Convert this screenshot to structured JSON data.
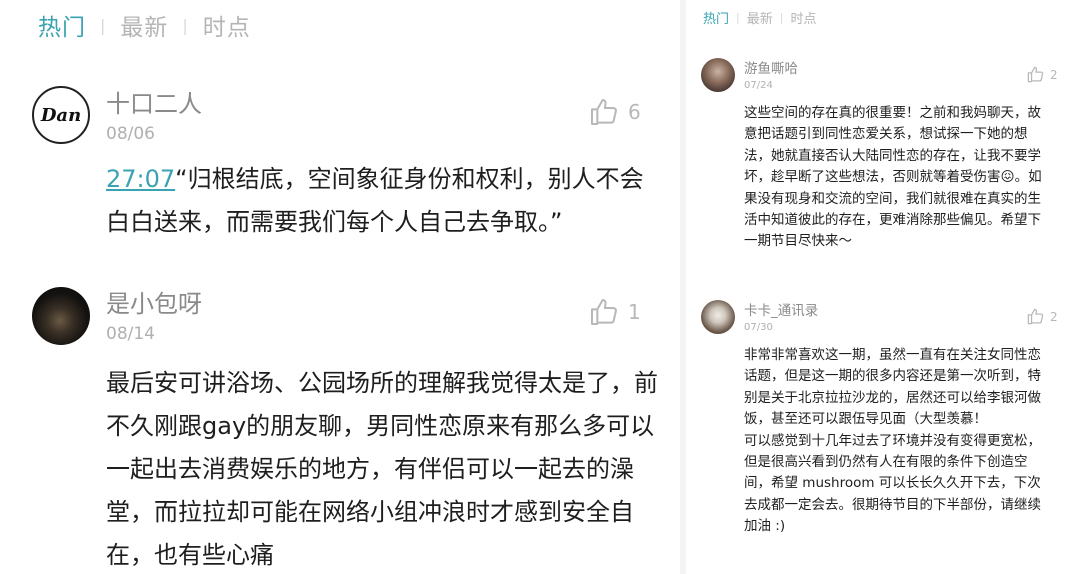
{
  "left": {
    "tabs": [
      "热门",
      "最新",
      "时点"
    ],
    "comments": [
      {
        "avatar_text": "Dan",
        "name": "十口二人",
        "date": "08/06",
        "likes": "6",
        "timestamp": "27:07",
        "text": "“归根结底，空间象征身份和权利，别人不会白白送来，而需要我们每个人自己去争取。”"
      },
      {
        "name": "是小包呀",
        "date": "08/14",
        "likes": "1",
        "text": "最后安可讲浴场、公园场所的理解我觉得太是了，前不久刚跟gay的朋友聊，男同性恋原来有那么多可以一起出去消费娱乐的地方，有伴侣可以一起去的澡堂，而拉拉却可能在网络小组冲浪时才感到安全自在，也有些心痛"
      }
    ]
  },
  "right": {
    "tabs": [
      "热门",
      "最新",
      "时点"
    ],
    "comments": [
      {
        "name": "游鱼嘶哈",
        "date": "07/24",
        "likes": "2",
        "text": "这些空间的存在真的很重要！之前和我妈聊天，故意把话题引到同性恋爱关系，想试探一下她的想法，她就直接否认大陆同性恋的存在，让我不要学坏，趁早断了这些想法，否则就等着受伤害😖。如果没有现身和交流的空间，我们就很难在真实的生活中知道彼此的存在，更难消除那些偏见。希望下一期节目尽快来～"
      },
      {
        "name": "卡卡_通讯录",
        "date": "07/30",
        "likes": "2",
        "text_p1": "非常非常喜欢这一期，虽然一直有在关注女同性恋话题，但是这一期的很多内容还是第一次听到，特别是关于北京拉拉沙龙的，居然还可以给李银河做饭，甚至还可以跟伍导见面（大型羡慕！",
        "text_p2": "可以感觉到十几年过去了环境并没有变得更宽松，但是很高兴看到仍然有人在有限的条件下创造空间，希望 mushroom 可以长长久久开下去，下次去成都一定会去。很期待节目的下半部份，请继续加油 :)"
      }
    ]
  },
  "colors": {
    "accent": "#3aa3b3",
    "muted": "#b5b5b5"
  },
  "icons": {
    "like": "thumbs-up-icon"
  }
}
